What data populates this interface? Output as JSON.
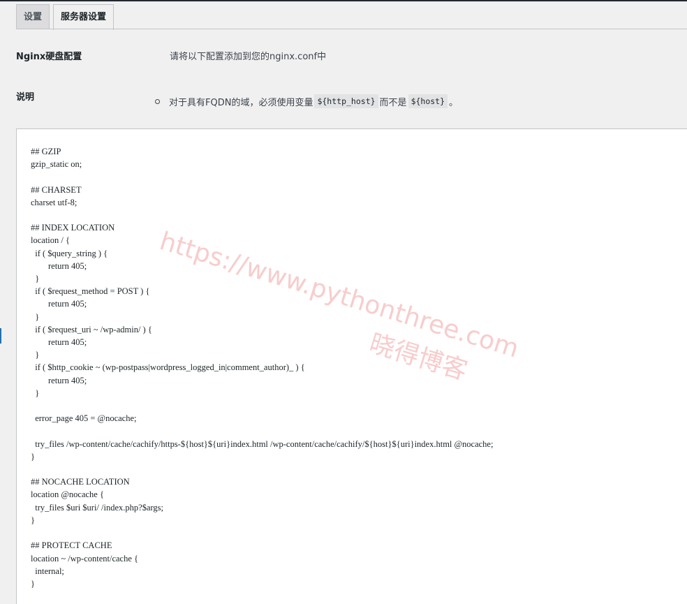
{
  "tabs": [
    {
      "label": "设置",
      "active": false
    },
    {
      "label": "服务器设置",
      "active": true
    }
  ],
  "nginx_row": {
    "label": "Nginx硬盘配置",
    "value": "请将以下配置添加到您的nginx.conf中"
  },
  "note_row": {
    "label": "说明",
    "text_before": "对于具有FQDN的域，必须使用变量",
    "code1": "${http_host}",
    "text_middle": "而不是",
    "code2": "${host}",
    "text_after": "。"
  },
  "config_code": "## GZIP\ngzip_static on;\n\n## CHARSET\ncharset utf-8;\n\n## INDEX LOCATION\nlocation / {\n  if ( $query_string ) {\n        return 405;\n  }\n  if ( $request_method = POST ) {\n        return 405;\n  }\n  if ( $request_uri ~ /wp-admin/ ) {\n        return 405;\n  }\n  if ( $http_cookie ~ (wp-postpass|wordpress_logged_in|comment_author)_ ) {\n        return 405;\n  }\n\n  error_page 405 = @nocache;\n\n  try_files /wp-content/cache/cachify/https-${host}${uri}index.html /wp-content/cache/cachify/${host}${uri}index.html @nocache;\n}\n\n## NOCACHE LOCATION\nlocation @nocache {\n  try_files $uri $uri/ /index.php?$args;\n}\n\n## PROTECT CACHE\nlocation ~ /wp-content/cache {\n  internal;\n}",
  "watermark": {
    "line1": "https://www.pythonthree.com",
    "line2": "晓得博客"
  }
}
